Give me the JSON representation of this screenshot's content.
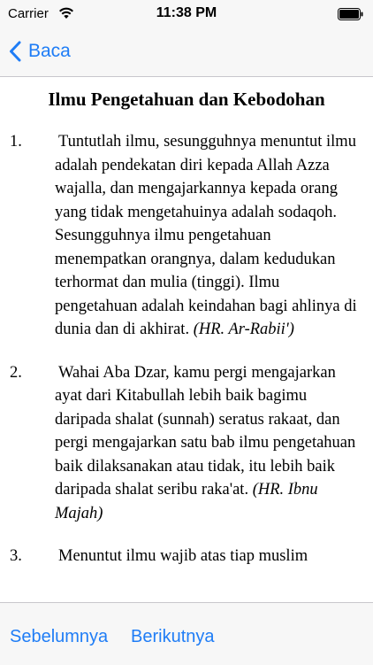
{
  "status_bar": {
    "carrier": "Carrier",
    "time": "11:38 PM"
  },
  "nav": {
    "back_label": "Baca"
  },
  "article": {
    "title": "Ilmu Pengetahuan dan Kebodohan",
    "items": [
      {
        "number": "1.",
        "text": "Tuntutlah ilmu, sesungguhnya menuntut ilmu adalah pendekatan diri kepada Allah Azza wajalla, dan mengajarkannya kepada orang yang tidak mengetahuinya adalah sodaqoh. Sesungguhnya ilmu pengetahuan menempatkan orangnya, dalam kedudukan terhormat dan mulia (tinggi). Ilmu pengetahuan adalah keindahan bagi ahlinya di dunia dan di akhirat.",
        "citation": "(HR. Ar-Rabii')"
      },
      {
        "number": "2.",
        "text": "Wahai Aba Dzar, kamu pergi mengajarkan ayat dari Kitabullah lebih baik bagimu daripada shalat (sunnah) seratus rakaat, dan pergi mengajarkan satu bab ilmu pengetahuan baik dilaksanakan atau tidak, itu lebih baik daripada shalat seribu raka'at.",
        "citation": "(HR. Ibnu Majah)"
      },
      {
        "number": "3.",
        "text": "Menuntut ilmu wajib atas tiap muslim",
        "citation": ""
      }
    ]
  },
  "toolbar": {
    "prev_label": "Sebelumnya",
    "next_label": "Berikutnya"
  }
}
